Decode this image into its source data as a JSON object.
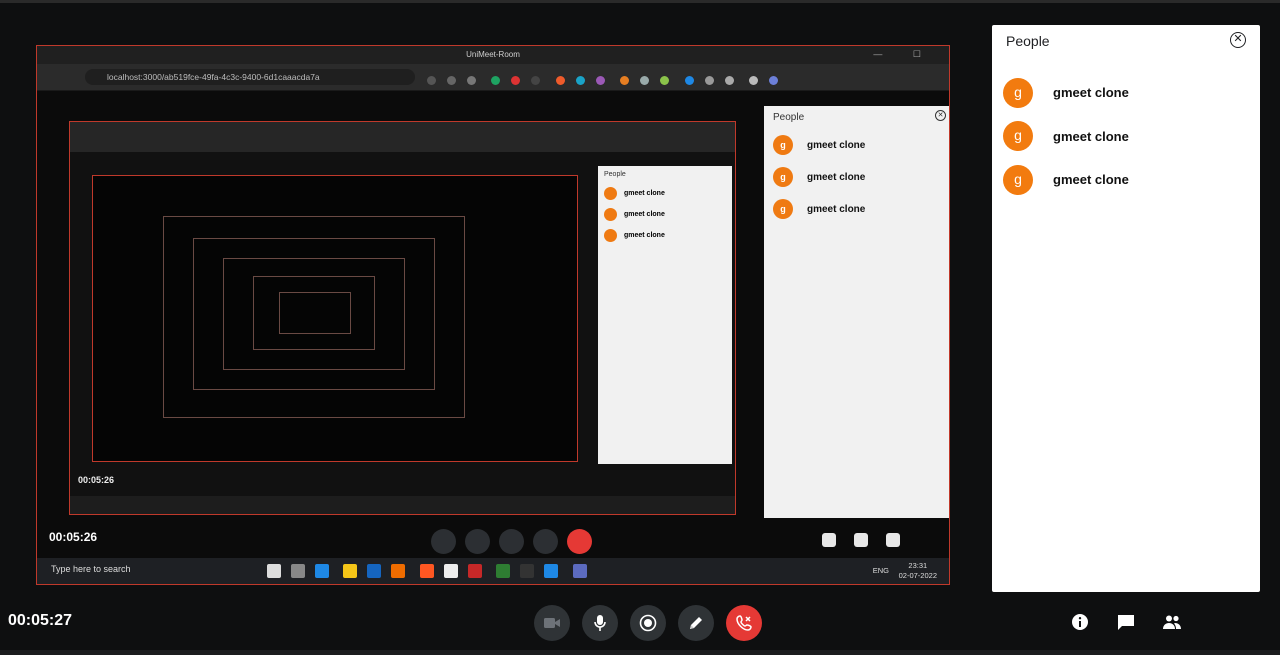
{
  "meeting": {
    "timer": "00:05:27"
  },
  "people_panel": {
    "title": "People",
    "participants": [
      {
        "initial": "g",
        "name": "gmeet clone"
      },
      {
        "initial": "g",
        "name": "gmeet clone"
      },
      {
        "initial": "g",
        "name": "gmeet clone"
      }
    ]
  },
  "shared_screen": {
    "window_title": "UniMeet-Room",
    "url": "localhost:3000/ab519fce-49fa-4c3c-9400-6d1caaacda7a",
    "timer": "00:05:26",
    "inner_timer": "00:05:26",
    "people_title": "People",
    "people": [
      "gmeet clone",
      "gmeet clone",
      "gmeet clone"
    ],
    "avatar_initial": "g",
    "taskbar_search": "Type here to search",
    "lang": "ENG",
    "clock_time": "23:31",
    "clock_date": "02-07-2022"
  },
  "controls": [
    "camera-off",
    "microphone",
    "present",
    "pen",
    "end-call"
  ],
  "side_actions": [
    "info",
    "chat",
    "people"
  ],
  "colors": {
    "avatar": "#f27b0f",
    "end_call": "#e53935",
    "control_bg": "#2f3336",
    "background": "#0e0f10"
  }
}
